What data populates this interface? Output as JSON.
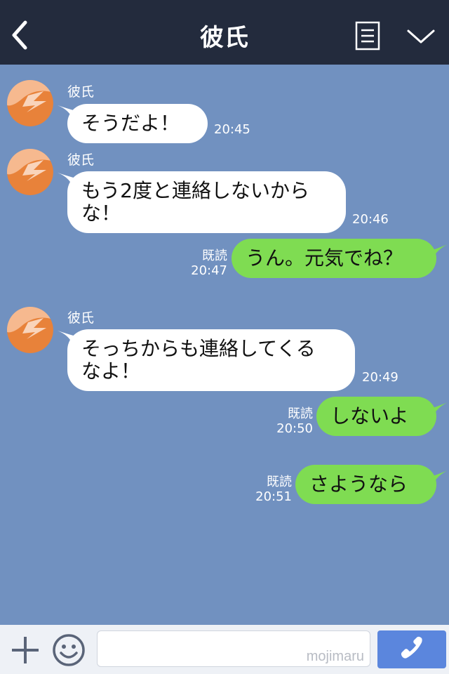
{
  "header": {
    "title": "彼氏",
    "back_icon": "chevron-left-icon",
    "menu_icon": "menu-list-icon",
    "collapse_icon": "chevron-down-icon",
    "background": "#232b3d"
  },
  "chat": {
    "background": "#7191c0",
    "incoming_bubble_color": "#ffffff",
    "outgoing_bubble_color": "#7fdc52",
    "messages": [
      {
        "sender": "彼氏",
        "text": "そうだよ！",
        "time": "20:45"
      },
      {
        "sender": "彼氏",
        "text": "もう2度と連絡しないから\nな！",
        "time": "20:46"
      },
      {
        "text": "うん。元気でね？",
        "read": "既読",
        "time": "20:47"
      },
      {
        "sender": "彼氏",
        "text": "そっちからも連絡してくる\nなよ！",
        "time": "20:49"
      },
      {
        "text": "しないよ",
        "read": "既読",
        "time": "20:50"
      },
      {
        "text": "さようなら",
        "read": "既読",
        "time": "20:51"
      }
    ]
  },
  "footer": {
    "add_icon": "plus-icon",
    "emoji_icon": "smiley-icon",
    "watermark": "mojimaru",
    "call_icon": "phone-icon",
    "call_button_color": "#5b86dd"
  }
}
